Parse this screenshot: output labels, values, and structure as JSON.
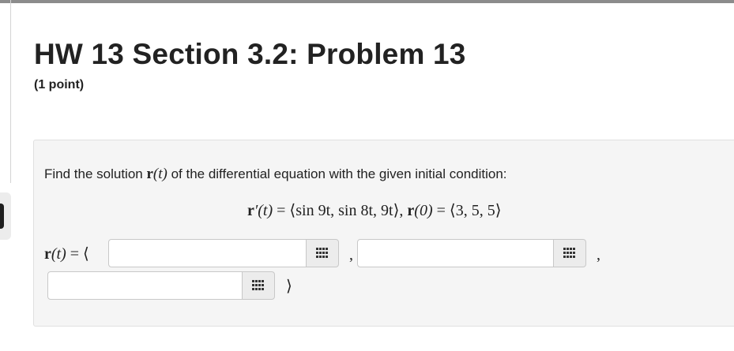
{
  "header": {
    "title": "HW 13 Section 3.2: Problem 13",
    "points": "(1 point)"
  },
  "problem": {
    "prompt_before": "Find the solution ",
    "prompt_r": "r",
    "prompt_t": "(t)",
    "prompt_after": " of the differential equation with the given initial condition:",
    "equation": {
      "r": "r",
      "prime_t": "′(t)",
      "eq1": " = ⟨sin 9t, sin 8t, 9t⟩, ",
      "r0_r": "r",
      "r0_arg": "(0)",
      "eq2": " = ⟨3, 5, 5⟩"
    },
    "answer_lhs": {
      "r": "r",
      "t": "(t)",
      "rest": " = ⟨"
    },
    "answer": {
      "field1_value": "",
      "field2_value": "",
      "field3_value": "",
      "comma": ",",
      "close": "⟩"
    },
    "equation_editor_icon": "grid-icon"
  }
}
